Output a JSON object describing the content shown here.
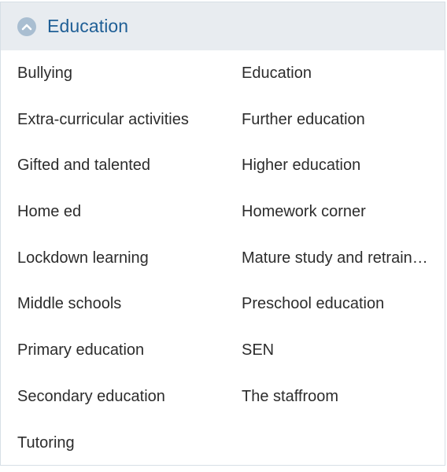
{
  "section": {
    "title": "Education",
    "toggle_icon": "chevron-up-icon",
    "accent_color": "#1f5f96",
    "header_background": "#e8ecf0"
  },
  "topics": {
    "left": [
      "Bullying",
      "Extra-curricular activities",
      "Gifted and talented",
      "Home ed",
      "Lockdown learning",
      "Middle schools",
      "Primary education",
      "Secondary education",
      "Tutoring"
    ],
    "right": [
      "Education",
      "Further education",
      "Higher education",
      "Homework corner",
      "Mature study and retraining",
      "Preschool education",
      "SEN",
      "The staffroom"
    ]
  }
}
